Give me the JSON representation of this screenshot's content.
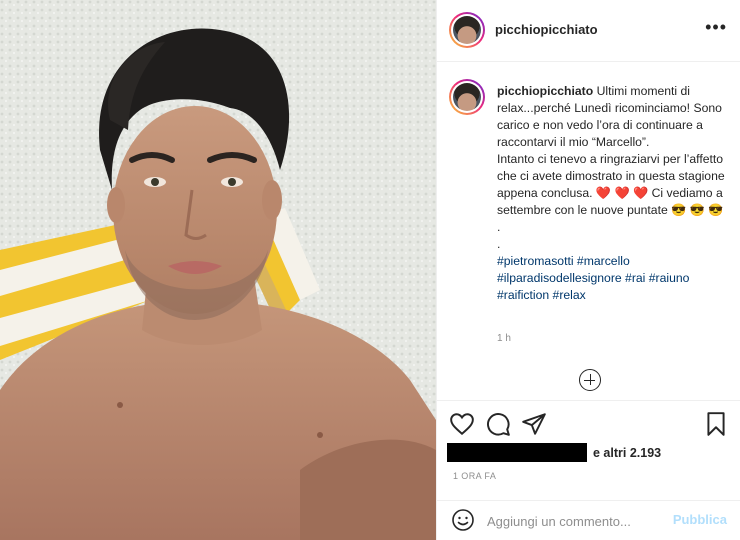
{
  "post": {
    "username": "picchiopicchiato",
    "more_icon": "more-horizontal-icon",
    "caption": {
      "username": "picchiopicchiato",
      "lines": [
        "Ultimi momenti di relax...perché Lunedì ricominciamo! Sono carico e non vedo l’ora di continuare a raccontarvi il mio “Marcello”.",
        "Intanto ci tenevo a ringraziarvi per l’affetto che ci avete dimostrato in questa stagione appena conclusa. ❤️ ❤️ ❤️ Ci vediamo a settembre con le nuove puntate 😎 😎 😎",
        ".",
        "."
      ],
      "hashtags": "#pietromasotti #marcello #ilparadisodellesignore #rai #raiuno #raifiction #relax"
    },
    "caption_time": "1 h",
    "load_more_icon": "plus-circle-icon",
    "actions": {
      "like_icon": "heart-icon",
      "comment_icon": "comment-bubble-icon",
      "share_icon": "paper-plane-icon",
      "save_icon": "bookmark-icon"
    },
    "likes_text": "e altri 2.193",
    "timestamp": "1 ORA FA",
    "comment_box": {
      "emoji_icon": "smiley-icon",
      "placeholder": "Aggiungi un commento...",
      "publish_label": "Pubblica"
    }
  },
  "colors": {
    "text": "#262626",
    "muted": "#8e8e8e",
    "link": "#00376b",
    "publish_disabled": "#b2dffc"
  }
}
